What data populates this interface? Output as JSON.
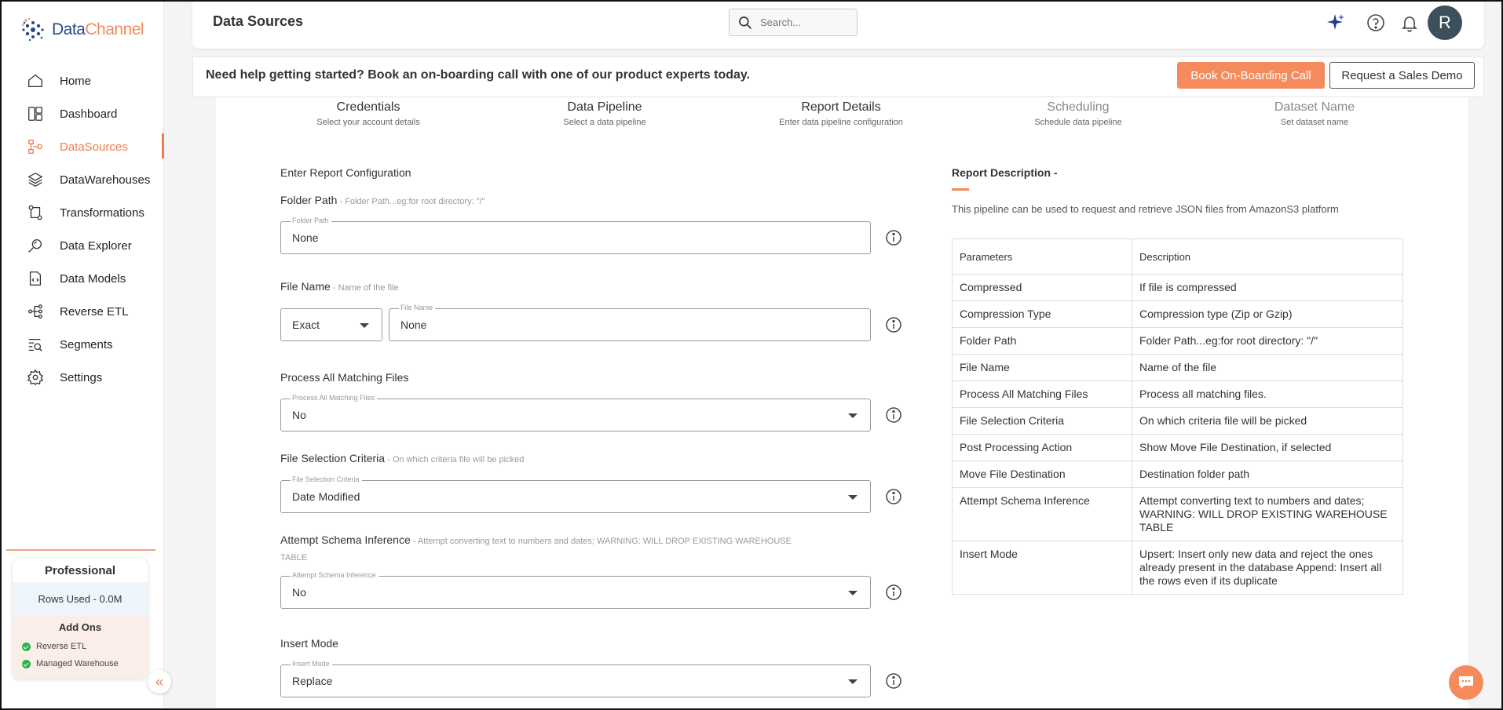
{
  "brand": {
    "name_part1": "Data",
    "name_part2": "Channel",
    "color_primary": "#2a4a8a",
    "color_accent": "#f07a4a"
  },
  "sidebar": {
    "items": [
      {
        "label": "Home",
        "icon": "home-icon"
      },
      {
        "label": "Dashboard",
        "icon": "dashboard-icon"
      },
      {
        "label": "DataSources",
        "icon": "datasources-icon",
        "active": true
      },
      {
        "label": "DataWarehouses",
        "icon": "layers-icon"
      },
      {
        "label": "Transformations",
        "icon": "transform-icon"
      },
      {
        "label": "Data Explorer",
        "icon": "explorer-icon"
      },
      {
        "label": "Data Models",
        "icon": "models-icon"
      },
      {
        "label": "Reverse ETL",
        "icon": "reverse-etl-icon"
      },
      {
        "label": "Segments",
        "icon": "segments-icon"
      },
      {
        "label": "Settings",
        "icon": "gear-icon"
      }
    ],
    "plan": {
      "title": "Professional",
      "rows_used": "Rows Used - 0.0M",
      "addons_title": "Add Ons",
      "addons": [
        "Reverse ETL",
        "Managed Warehouse"
      ]
    },
    "collapse_glyph": "«"
  },
  "header": {
    "title": "Data Sources",
    "search_placeholder": "Search...",
    "avatar_initial": "R"
  },
  "banner": {
    "text": "Need help getting started? Book an on-boarding call with one of our product experts today.",
    "primary_button": "Book On-Boarding Call",
    "secondary_button": "Request a Sales Demo"
  },
  "steps": [
    {
      "title": "Credentials",
      "sub": "Select your account details"
    },
    {
      "title": "Data Pipeline",
      "sub": "Select a data pipeline"
    },
    {
      "title": "Report Details",
      "sub": "Enter data pipeline configuration"
    },
    {
      "title": "Scheduling",
      "sub": "Schedule data pipeline"
    },
    {
      "title": "Dataset Name",
      "sub": "Set dataset name"
    }
  ],
  "form": {
    "heading": "Enter Report Configuration",
    "folder_path": {
      "label": "Folder Path",
      "hint": " - Folder Path...eg:for root directory: \"/\"",
      "legend": "Folder Path",
      "value": "None"
    },
    "file_name": {
      "label": "File Name",
      "hint": " - Name of the file",
      "match_value": "Exact",
      "legend": "File Name",
      "value": "None"
    },
    "process_all": {
      "label": "Process All Matching Files",
      "legend": "Process All Matching Files",
      "value": "No"
    },
    "selection_criteria": {
      "label": "File Selection Criteria",
      "hint": " - On which criteria file will be picked",
      "legend": "File Selection Criteria",
      "value": "Date Modified"
    },
    "schema_inference": {
      "label": "Attempt Schema Inference",
      "hint": " - Attempt converting text to numbers and dates; WARNING: WILL DROP EXISTING WAREHOUSE TABLE",
      "legend": "Attempt Schema Inference",
      "value": "No"
    },
    "insert_mode": {
      "label": "Insert Mode",
      "legend": "Insert Mode",
      "value": "Replace"
    }
  },
  "description": {
    "title": "Report Description -",
    "text": "This pipeline can be used to request and retrieve JSON files from AmazonS3 platform",
    "columns": [
      "Parameters",
      "Description"
    ],
    "rows": [
      [
        "Compressed",
        "If file is compressed"
      ],
      [
        "Compression Type",
        "Compression type (Zip or Gzip)"
      ],
      [
        "Folder Path",
        "Folder Path...eg:for root directory: \"/\""
      ],
      [
        "File Name",
        "Name of the file"
      ],
      [
        "Process All Matching Files",
        "Process all matching files."
      ],
      [
        "File Selection Criteria",
        "On which criteria file will be picked"
      ],
      [
        "Post Processing Action",
        "Show Move File Destination, if selected"
      ],
      [
        "Move File Destination",
        "Destination folder path"
      ],
      [
        "Attempt Schema Inference",
        "Attempt converting text to numbers and dates; WARNING: WILL DROP EXISTING WAREHOUSE TABLE"
      ],
      [
        "Insert Mode",
        "Upsert: Insert only new data and reject the ones already present in the database Append: Insert all the rows even if its duplicate"
      ]
    ]
  }
}
